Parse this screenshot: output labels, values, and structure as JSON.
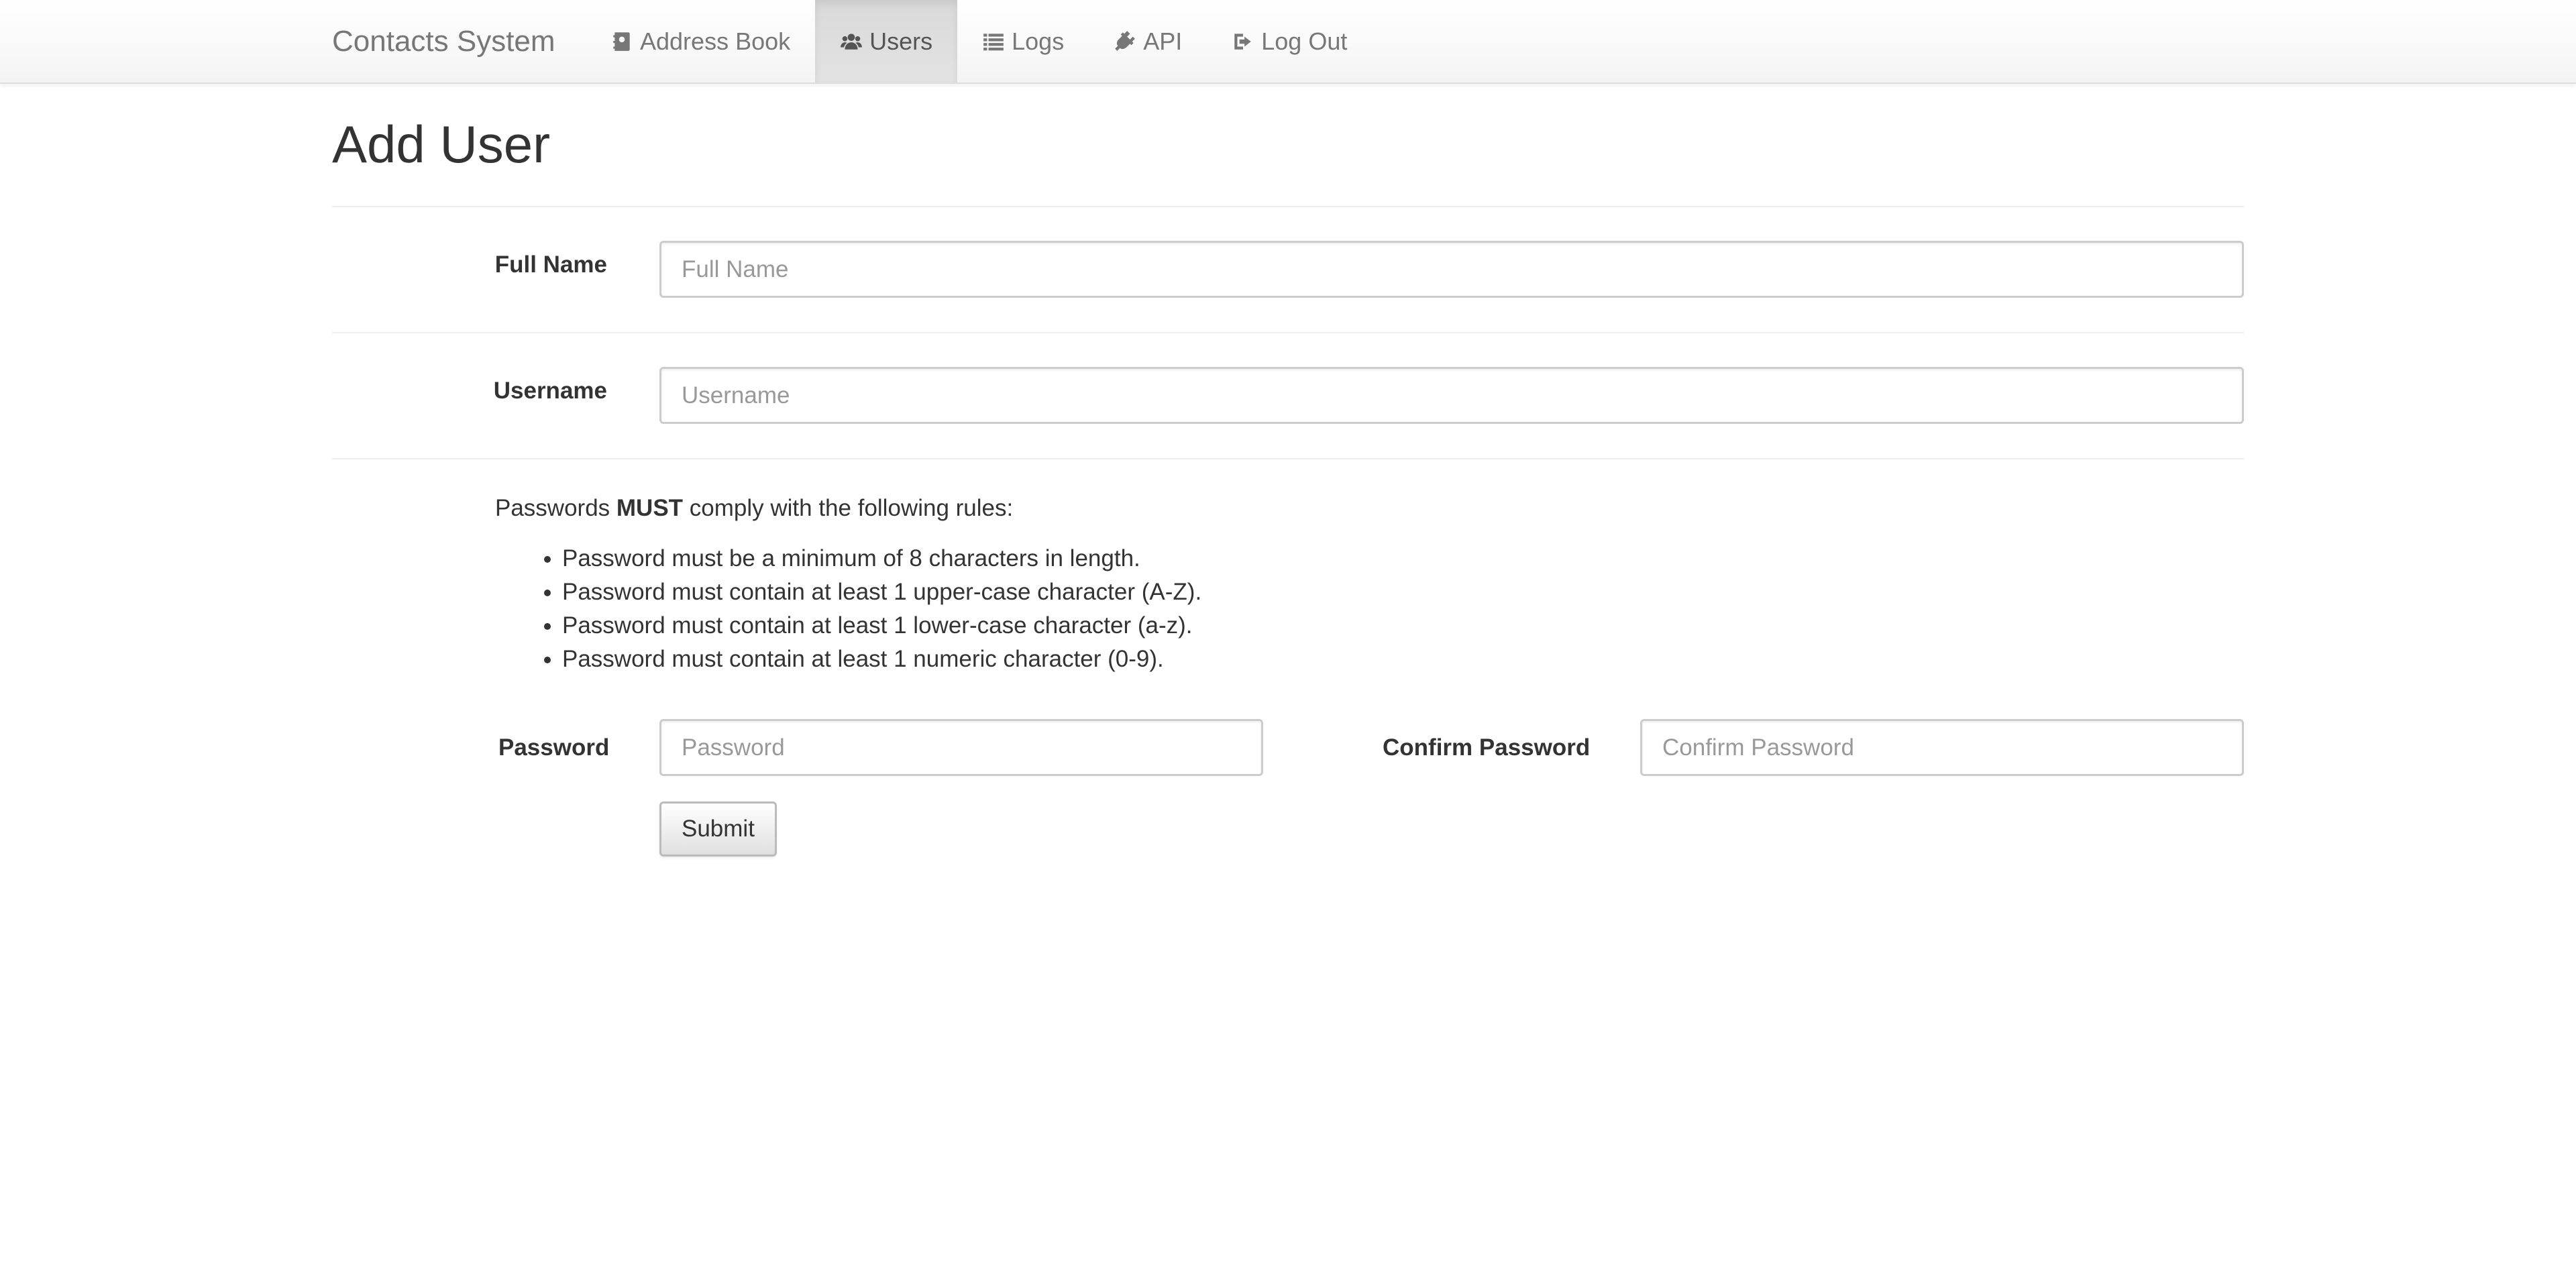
{
  "navbar": {
    "brand": "Contacts System",
    "items": [
      {
        "label": "Address Book",
        "icon": "address-book-icon",
        "active": false
      },
      {
        "label": "Users",
        "icon": "users-icon",
        "active": true
      },
      {
        "label": "Logs",
        "icon": "list-icon",
        "active": false
      },
      {
        "label": "API",
        "icon": "plug-icon",
        "active": false
      },
      {
        "label": "Log Out",
        "icon": "sign-out-icon",
        "active": false
      }
    ]
  },
  "page": {
    "title": "Add User"
  },
  "form": {
    "full_name": {
      "label": "Full Name",
      "placeholder": "Full Name",
      "value": ""
    },
    "username": {
      "label": "Username",
      "placeholder": "Username",
      "value": ""
    },
    "password_rules": {
      "intro_prefix": "Passwords ",
      "intro_emphasis": "MUST",
      "intro_suffix": " comply with the following rules:",
      "rules": [
        "Password must be a minimum of 8 characters in length.",
        "Password must contain at least 1 upper-case character (A-Z).",
        "Password must contain at least 1 lower-case character (a-z).",
        "Password must contain at least 1 numeric character (0-9)."
      ]
    },
    "password": {
      "label": "Password",
      "placeholder": "Password",
      "value": ""
    },
    "confirm_password": {
      "label": "Confirm Password",
      "placeholder": "Confirm Password",
      "value": ""
    },
    "submit_label": "Submit"
  },
  "colors": {
    "navbar_text": "#777777",
    "active_tab_bg": "#dddddd",
    "input_border": "#cccccc",
    "placeholder": "#999999"
  }
}
